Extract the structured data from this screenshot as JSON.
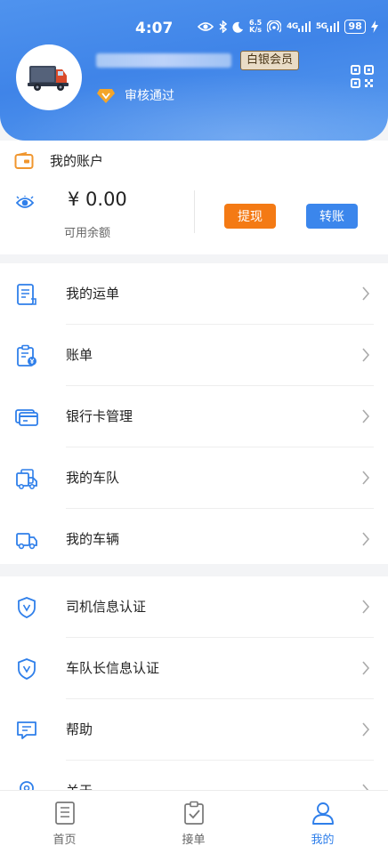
{
  "status_bar": {
    "time": "4:07",
    "net_speed_value": "6.5",
    "net_speed_unit": "K/s",
    "signal_1": "4G",
    "signal_2": "5G",
    "battery": "98"
  },
  "profile": {
    "member_level": "白银会员",
    "verify_status": "审核通过"
  },
  "account": {
    "title": "我的账户",
    "balance": "¥ 0.00",
    "balance_label": "可用余额",
    "withdraw_label": "提现",
    "transfer_label": "转账"
  },
  "menu_group_1": [
    {
      "label": "我的运单",
      "icon": "document-icon"
    },
    {
      "label": "账单",
      "icon": "bill-icon"
    },
    {
      "label": "银行卡管理",
      "icon": "bank-card-icon"
    },
    {
      "label": "我的车队",
      "icon": "fleet-icon"
    },
    {
      "label": "我的车辆",
      "icon": "truck-icon"
    }
  ],
  "menu_group_2": [
    {
      "label": "司机信息认证",
      "icon": "shield-v-icon"
    },
    {
      "label": "车队长信息认证",
      "icon": "shield-v-icon"
    },
    {
      "label": "帮助",
      "icon": "help-message-icon"
    },
    {
      "label": "关于",
      "icon": "location-icon"
    }
  ],
  "tabbar": [
    {
      "label": "首页",
      "icon": "home-doc-icon",
      "active": false
    },
    {
      "label": "接单",
      "icon": "accept-order-icon",
      "active": false
    },
    {
      "label": "我的",
      "icon": "user-icon",
      "active": true
    }
  ],
  "colors": {
    "brand_blue": "#3f84e8",
    "withdraw_orange": "#f47a14",
    "transfer_blue": "#3b86ec",
    "active_tab": "#2f7fea"
  }
}
